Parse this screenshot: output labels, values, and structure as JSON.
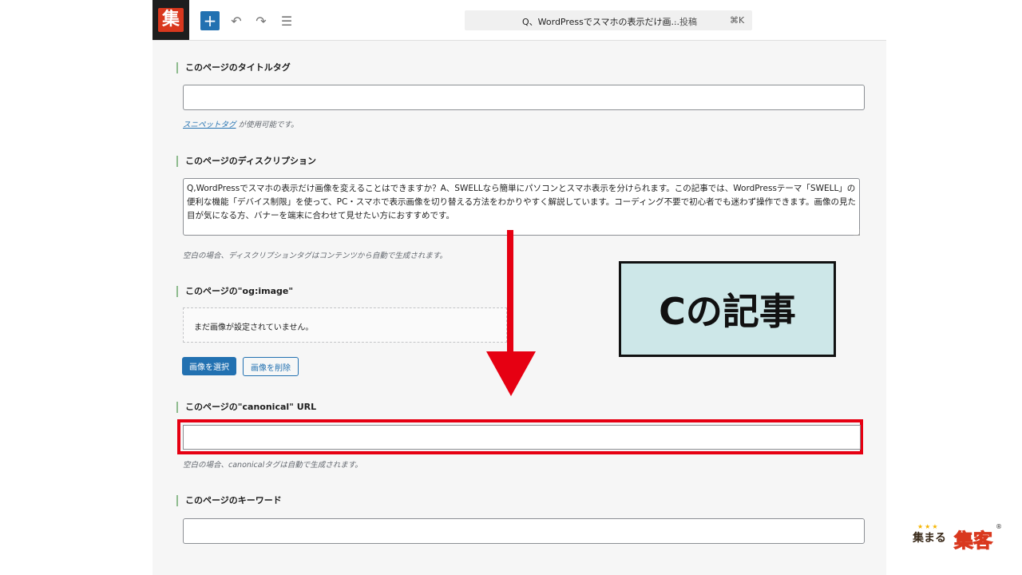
{
  "toolbar": {
    "site_logo_char": "集",
    "add_symbol": "+",
    "undo_symbol": "↶",
    "redo_symbol": "↷",
    "list_symbol": "☰",
    "command_title": "Q、WordPressでスマホの表示だけ画...",
    "command_type": "· 投稿",
    "command_shortcut": "⌘K"
  },
  "title_tag": {
    "label": "このページのタイトルタグ",
    "value": "",
    "help_link": "スニペットタグ",
    "help_text": " が使用可能です。"
  },
  "description": {
    "label": "このページのディスクリプション",
    "value": "Q,WordPressでスマホの表示だけ画像を変えることはできますか？A、SWELLなら簡単にパソコンとスマホ表示を分けられます。この記事では、WordPressテーマ「SWELL」の便利な機能「デバイス制限」を使って、PC・スマホで表示画像を切り替える方法をわかりやすく解説しています。コーディング不要で初心者でも迷わず操作できます。画像の見た目が気になる方、バナーを端末に合わせて見せたい方におすすめです。",
    "help_text": "空白の場合、ディスクリプションタグはコンテンツから自動で生成されます。"
  },
  "og_image": {
    "label": "このページの\"og:image\"",
    "empty_text": "まだ画像が設定されていません。",
    "select_button": "画像を選択",
    "delete_button": "画像を削除"
  },
  "canonical": {
    "label": "このページの\"canonical\" URL",
    "value": "",
    "help_text": "空白の場合、canonicalタグは自動で生成されます。"
  },
  "keywords": {
    "label": "このページのキーワード",
    "value": ""
  },
  "annotation": {
    "callout_text": "Cの記事",
    "highlight_color": "#e60012",
    "callout_bg": "#cde7e8"
  },
  "brand": {
    "stars": "★★★",
    "prefix": "集まる",
    "main": "集客",
    "reg": "®"
  }
}
